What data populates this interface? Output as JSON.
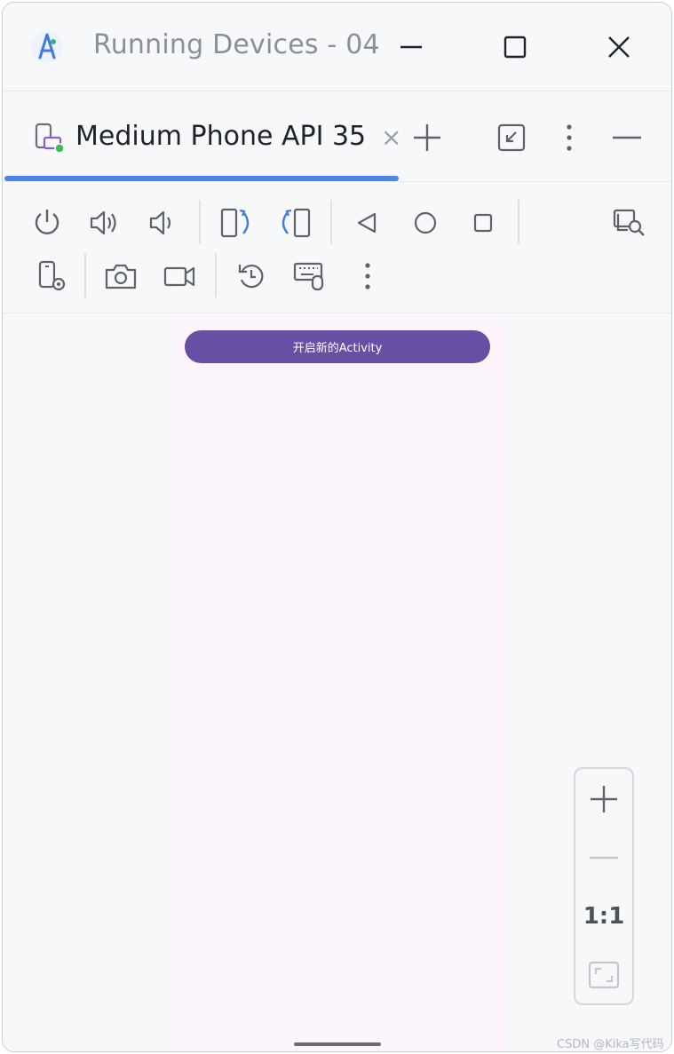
{
  "window": {
    "title": "Running Devices - 04"
  },
  "tabs": [
    {
      "label": "Medium Phone API 35",
      "close": "×"
    }
  ],
  "device": {
    "button_label": "开启新的Activity"
  },
  "zoom": {
    "one_to_one": "1:1"
  },
  "watermark": "CSDN @Kika写代码",
  "colors": {
    "accent": "#4a86e8",
    "activity_button": "#6750a4",
    "screen_bg": "#fcf6fc",
    "icon": "#5f6368"
  }
}
